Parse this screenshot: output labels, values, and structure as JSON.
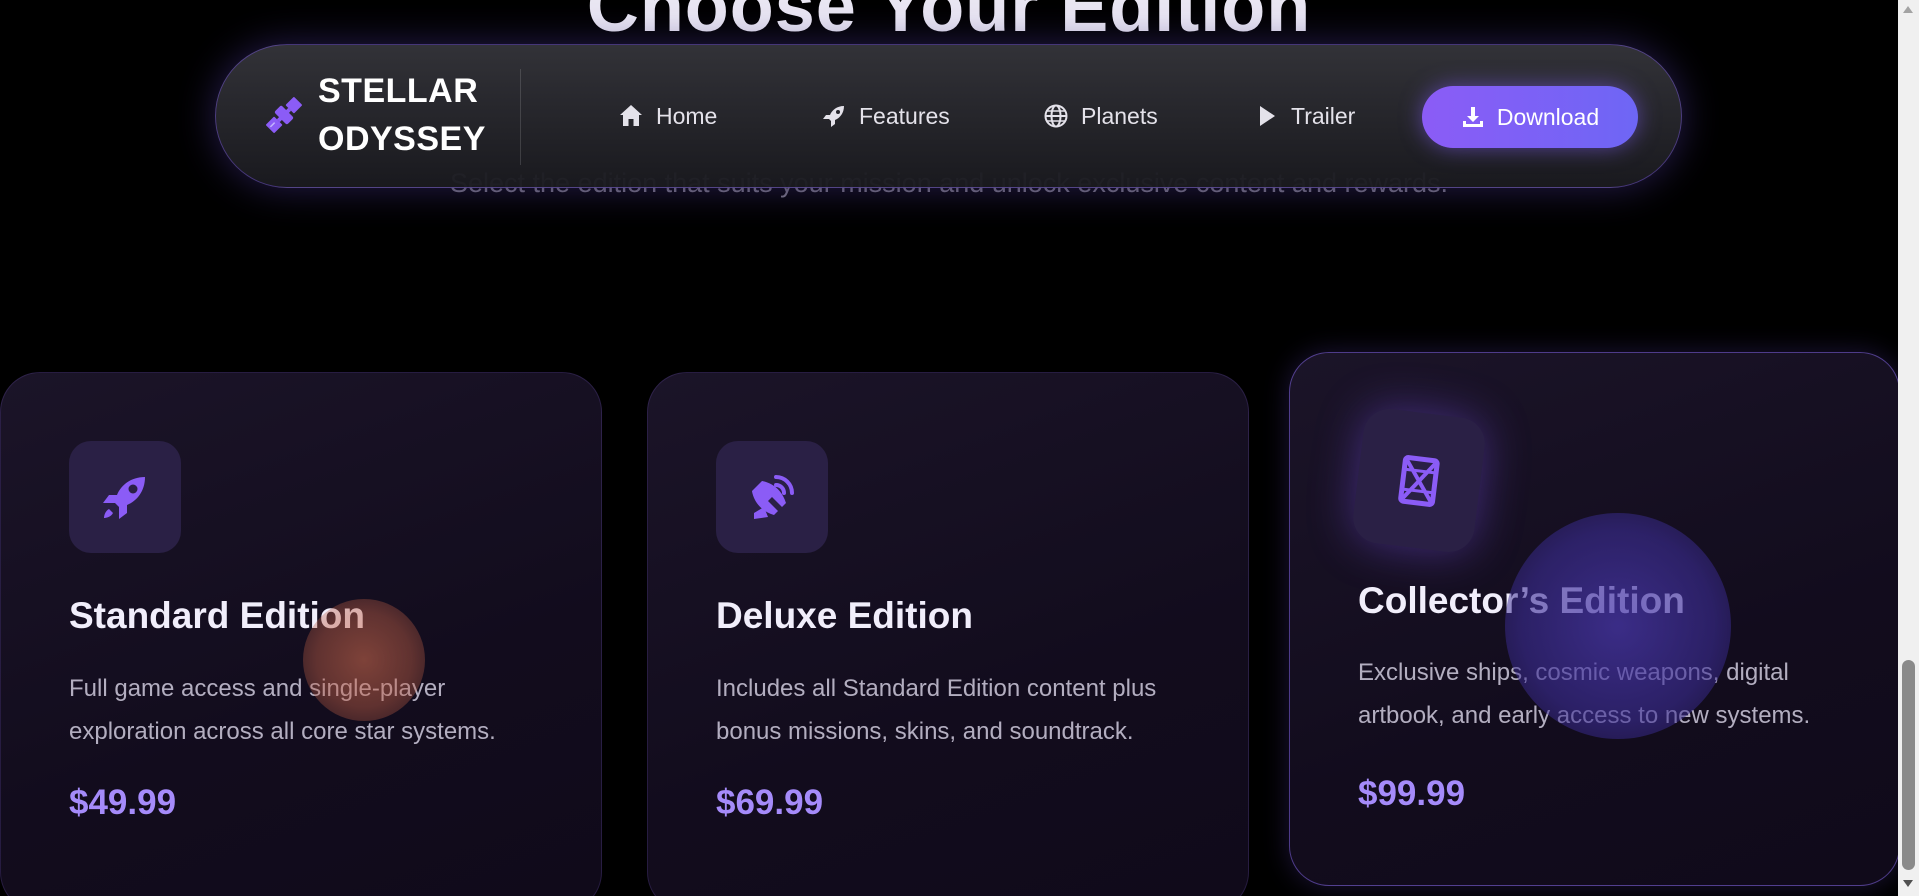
{
  "section": {
    "title": "Choose Your Edition",
    "subtitle": "Select the edition that suits your mission and unlock exclusive content and rewards."
  },
  "nav": {
    "brand_line1": "STELLAR",
    "brand_line2": "ODYSSEY",
    "brand_icon": "satellite-icon",
    "items": [
      {
        "label": "Home",
        "icon": "home-icon"
      },
      {
        "label": "Features",
        "icon": "rocket-icon"
      },
      {
        "label": "Planets",
        "icon": "globe-icon"
      },
      {
        "label": "Trailer",
        "icon": "play-icon"
      }
    ],
    "download_label": "Download",
    "download_icon": "download-icon"
  },
  "editions": [
    {
      "title": "Standard Edition",
      "description": "Full game access and single-player exploration across all core star systems.",
      "price": "$49.99",
      "icon": "rocket-icon"
    },
    {
      "title": "Deluxe Edition",
      "description": "Includes all Standard Edition content plus bonus missions, skins, and soundtrack.",
      "price": "$69.99",
      "icon": "satellite-dish-icon"
    },
    {
      "title": "Collector’s Edition",
      "description": "Exclusive ships, cosmic weapons, digital artbook, and early access to new systems.",
      "price": "$99.99",
      "icon": "artifact-icon"
    }
  ],
  "colors": {
    "accent": "#8b5cf6",
    "price": "#a58bfa",
    "background": "#000000",
    "card": "#160f22"
  }
}
